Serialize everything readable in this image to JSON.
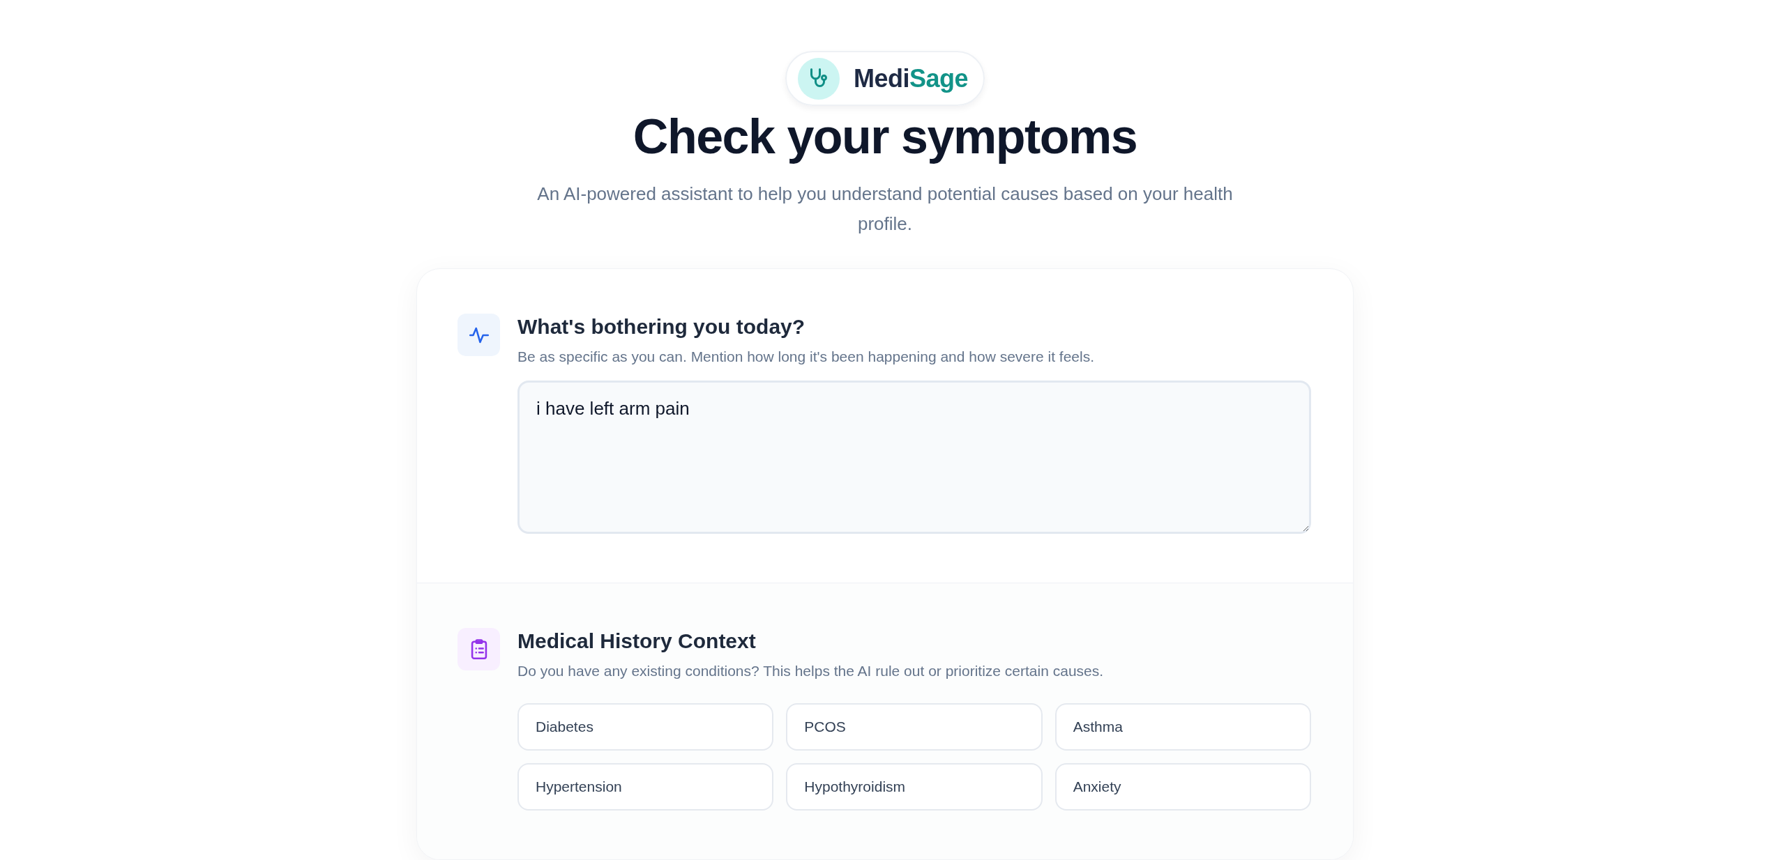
{
  "brand": {
    "name_part_1": "Medi",
    "name_part_2": "Sage"
  },
  "title": "Check your symptoms",
  "subtitle": "An AI-powered assistant to help you understand potential causes based on your health profile.",
  "symptoms": {
    "heading": "What's bothering you today?",
    "description": "Be as specific as you can. Mention how long it's been happening and how severe it feels.",
    "value": "i have left arm pain"
  },
  "history": {
    "heading": "Medical History Context",
    "description": "Do you have any existing conditions? This helps the AI rule out or prioritize certain causes.",
    "conditions": [
      {
        "label": "Diabetes",
        "selected": false
      },
      {
        "label": "PCOS",
        "selected": false
      },
      {
        "label": "Asthma",
        "selected": false
      },
      {
        "label": "Hypertension",
        "selected": false
      },
      {
        "label": "Hypothyroidism",
        "selected": false
      },
      {
        "label": "Anxiety",
        "selected": false
      }
    ]
  }
}
